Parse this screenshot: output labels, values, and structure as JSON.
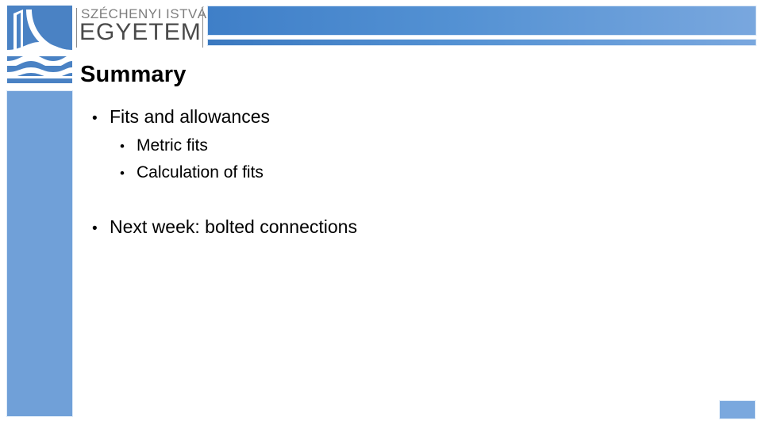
{
  "branding": {
    "logo_icon": "szechenyi-bridge-emblem-icon",
    "wordmark_line1": "SZÉCHENYI ISTVÁN",
    "wordmark_line2": "EGYETEM",
    "accent_color": "#4a82c4",
    "header_gradient_start": "#3f7fc8",
    "header_gradient_end": "#79a7de",
    "side_column_color": "#70a0d8",
    "corner_block_color": "#7aa8de"
  },
  "slide": {
    "title": "Summary",
    "bullets": [
      {
        "level": 1,
        "marker": "•",
        "text": "Fits and allowances"
      },
      {
        "level": 2,
        "marker": "•",
        "text": "Metric fits"
      },
      {
        "level": 2,
        "marker": "•",
        "text": "Calculation of fits"
      },
      {
        "level": 1,
        "marker": "•",
        "text": "Next week: bolted connections"
      }
    ]
  }
}
